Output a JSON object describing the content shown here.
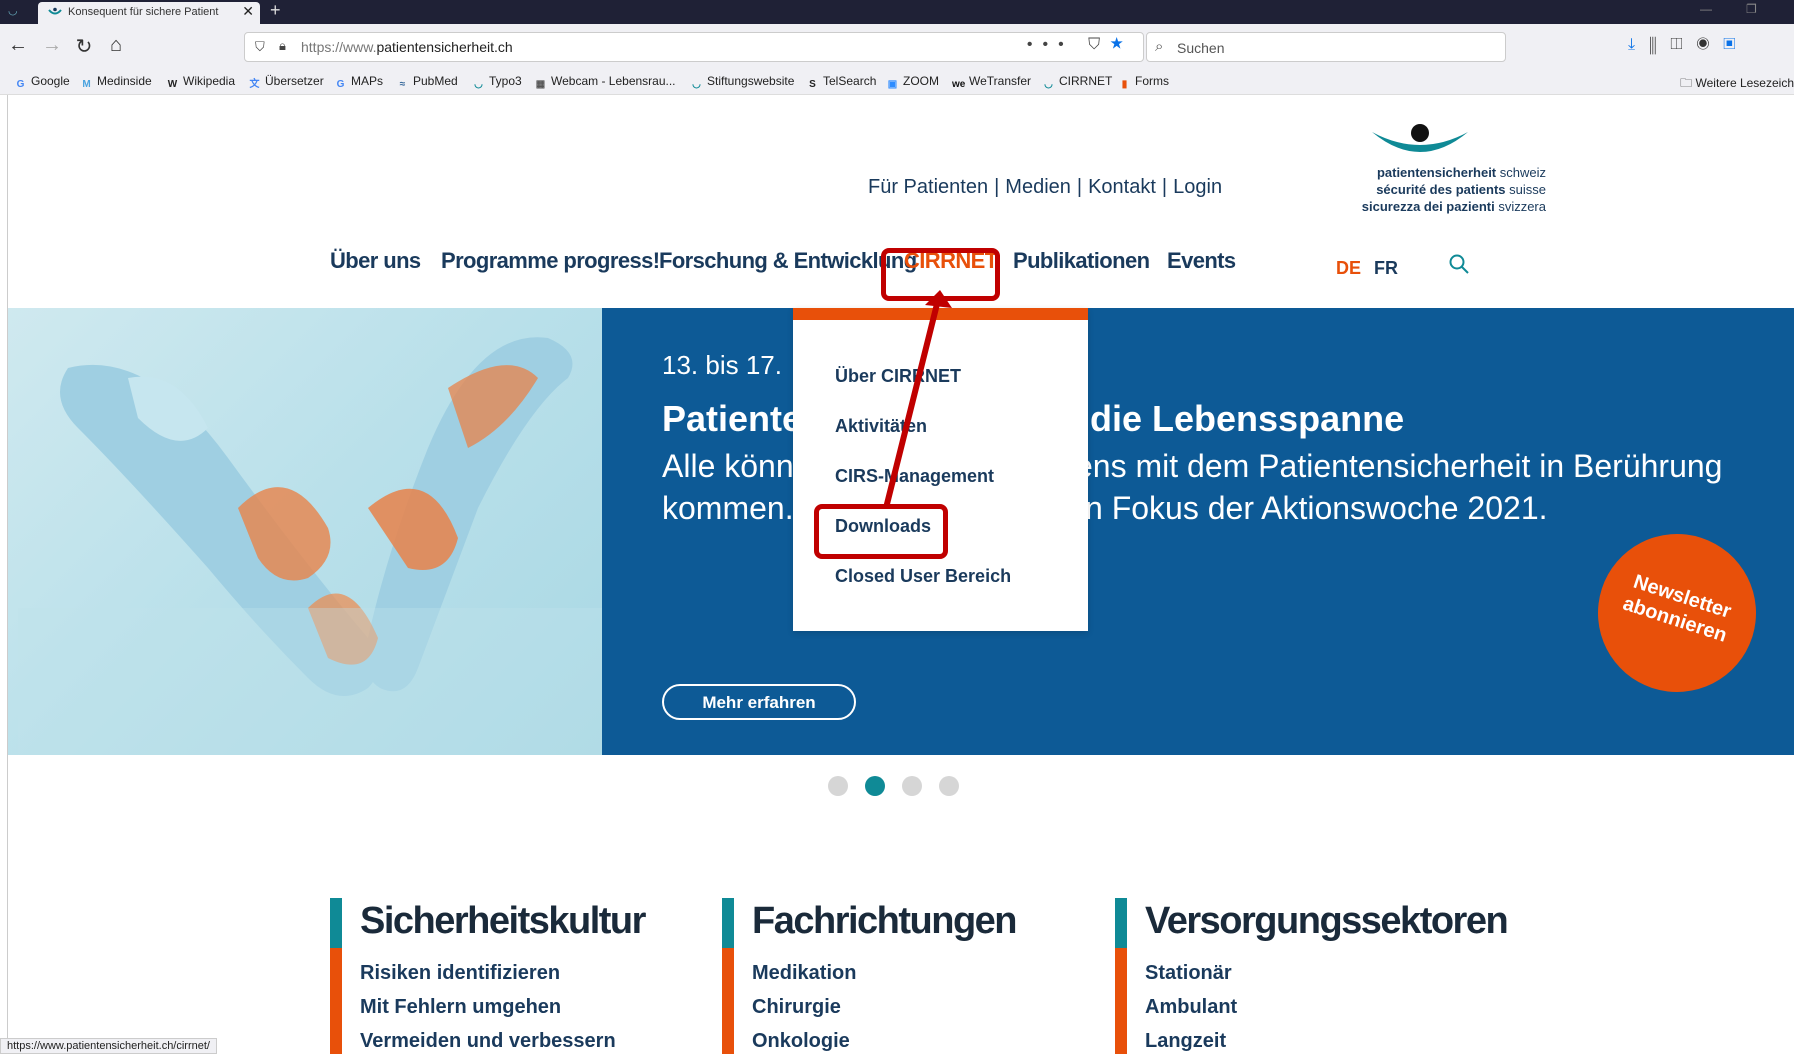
{
  "browser": {
    "tab_title": "Konsequent für sichere Patient",
    "url_proto": "https://www.",
    "url_host": "patientensicherheit.ch",
    "search_placeholder": "Suchen",
    "status_url": "https://www.patientensicherheit.ch/cirrnet/",
    "bookmarks": [
      {
        "label": "Google",
        "icon": "google-icon",
        "color": "#4285f4",
        "glyph": "G"
      },
      {
        "label": "Medinside",
        "icon": "medinside-icon",
        "color": "#4aa3df",
        "glyph": "M"
      },
      {
        "label": "Wikipedia",
        "icon": "wikipedia-icon",
        "color": "#222222",
        "glyph": "W"
      },
      {
        "label": "Übersetzer",
        "icon": "translator-icon",
        "color": "#4285f4",
        "glyph": "文"
      },
      {
        "label": "MAPs",
        "icon": "google-maps-icon",
        "color": "#4285f4",
        "glyph": "G"
      },
      {
        "label": "PubMed",
        "icon": "pubmed-icon",
        "color": "#336699",
        "glyph": "≈"
      },
      {
        "label": "Typo3",
        "icon": "ps-logo-icon",
        "color": "#0f8a96",
        "glyph": "◡"
      },
      {
        "label": "Webcam - Lebensrau...",
        "icon": "webcam-icon",
        "color": "#555555",
        "glyph": "▦"
      },
      {
        "label": "Stiftungswebsite",
        "icon": "ps-logo-icon",
        "color": "#0f8a96",
        "glyph": "◡"
      },
      {
        "label": "TelSearch",
        "icon": "telsearch-icon",
        "color": "#222222",
        "glyph": "S"
      },
      {
        "label": "ZOOM",
        "icon": "zoom-icon",
        "color": "#2d8cff",
        "glyph": "▣"
      },
      {
        "label": "WeTransfer",
        "icon": "wetransfer-icon",
        "color": "#111111",
        "glyph": "we"
      },
      {
        "label": "CIRRNET",
        "icon": "ps-logo-icon",
        "color": "#0f8a96",
        "glyph": "◡"
      },
      {
        "label": "Forms",
        "icon": "office-icon",
        "color": "#e8500a",
        "glyph": "▮"
      }
    ],
    "bookmarks_more": "Weitere Lesezeich"
  },
  "site": {
    "topnav": [
      "Für Patienten",
      "Medien",
      "Kontakt",
      "Login"
    ],
    "logo_lines": [
      {
        "bold": "patientensicherheit",
        "light": " schweiz"
      },
      {
        "bold": "sécurité des patients",
        "light": " suisse"
      },
      {
        "bold": "sicurezza dei pazienti",
        "light": " svizzera"
      }
    ],
    "mainnav": [
      "Über uns",
      "Programme progress!",
      "Forschung & Entwicklung",
      "CIRRNET",
      "Publikationen",
      "Events"
    ],
    "lang": {
      "de": "DE",
      "fr": "FR"
    }
  },
  "hero": {
    "date": "13. bis 17. ",
    "title_a": "Patiente",
    "title_b": "die Lebensspanne",
    "line1_a": "Alle könn",
    "line1_b": "ens mit dem Patientensicherheit in Berührung",
    "line2_a": "kommen.",
    "line2_b": "n Fokus der Aktionswoche 2021.",
    "button": "Mehr erfahren",
    "newsletter_1": "Newsletter",
    "newsletter_2": "abonnieren",
    "slides": 4,
    "active_slide": 2
  },
  "dropdown": {
    "items": [
      "Über CIRRNET",
      "Aktivitäten",
      "CIRS-Management",
      "Downloads",
      "Closed User Bereich"
    ]
  },
  "categories": [
    {
      "title": "Sicherheitskultur",
      "links": [
        "Risiken identifizieren",
        "Mit Fehlern umgehen",
        "Vermeiden und verbessern"
      ]
    },
    {
      "title": "Fachrichtungen",
      "links": [
        "Medikation",
        "Chirurgie",
        "Onkologie"
      ]
    },
    {
      "title": "Versorgungssektoren",
      "links": [
        "Stationär",
        "Ambulant",
        "Langzeit"
      ]
    }
  ],
  "colors": {
    "brand_blue": "#0d5a96",
    "brand_orange": "#e8500a",
    "brand_teal": "#0f8a96",
    "annotation_red": "#c00000"
  }
}
